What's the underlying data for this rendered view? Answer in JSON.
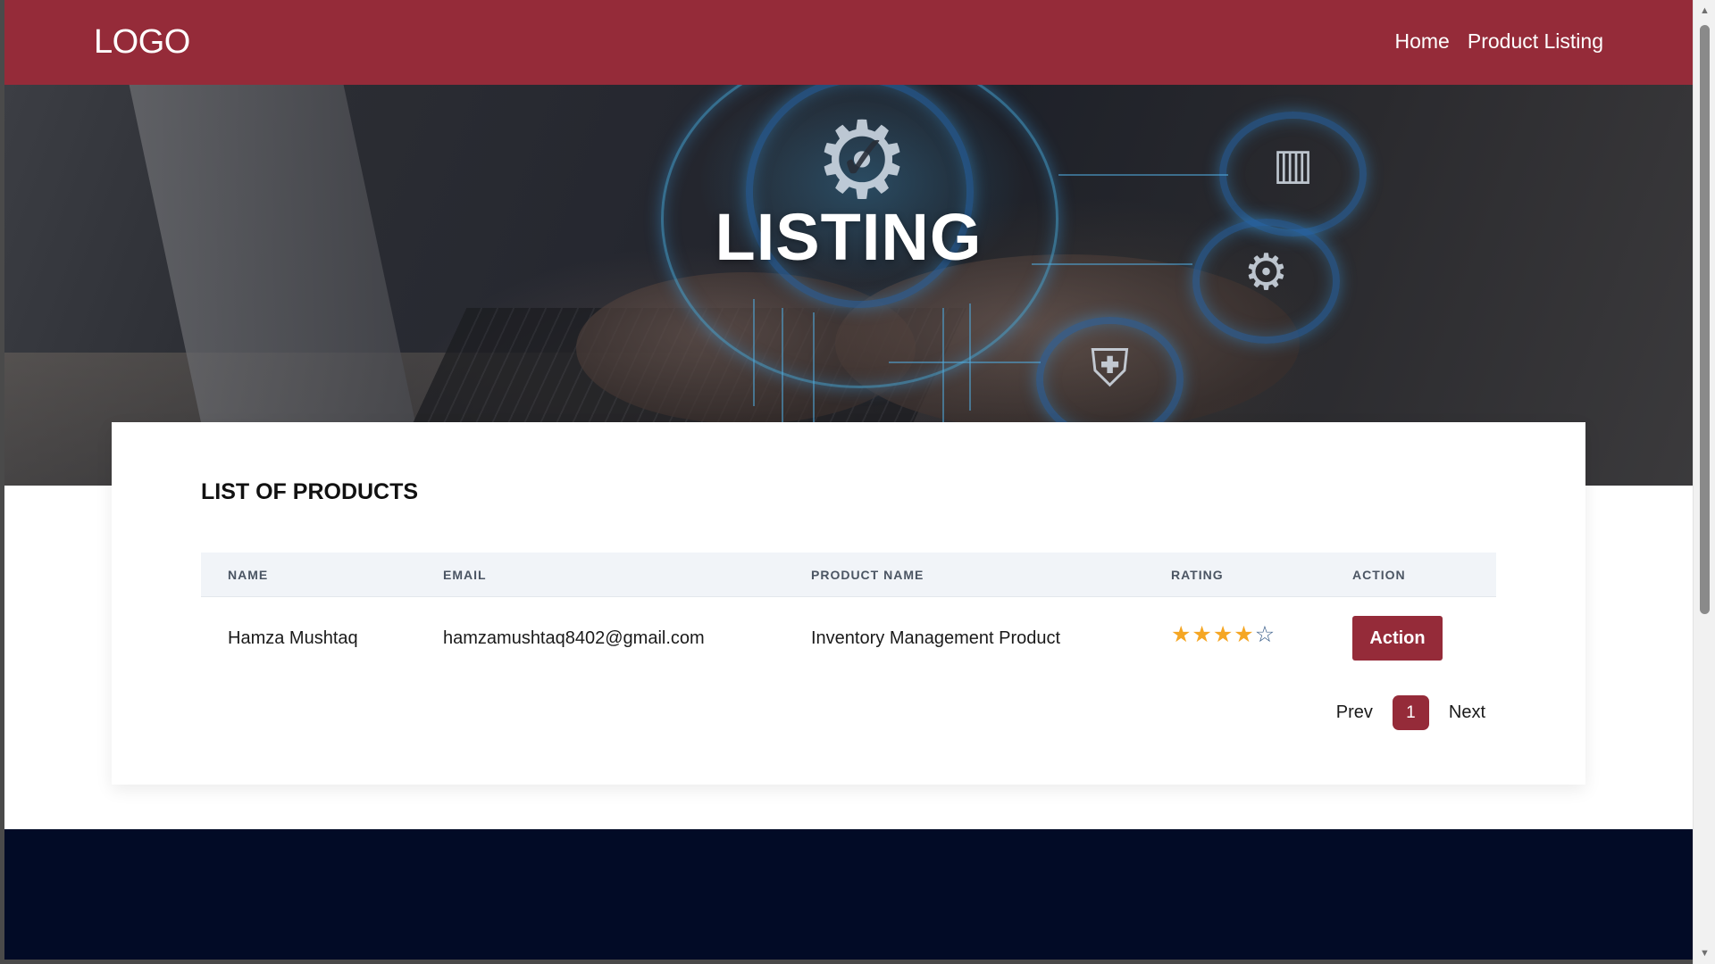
{
  "navbar": {
    "logo": "LOGO",
    "links": [
      "Home",
      "Product Listing"
    ]
  },
  "hero": {
    "title": "LISTING"
  },
  "products": {
    "heading": "LIST OF PRODUCTS",
    "columns": [
      "NAME",
      "EMAIL",
      "PRODUCT NAME",
      "RATING",
      "ACTION"
    ],
    "rows": [
      {
        "name": "Hamza Mushtaq",
        "email": "hamzamushtaq8402@gmail.com",
        "product_name": "Inventory Management Product",
        "rating": 4,
        "rating_max": 5,
        "action_label": "Action"
      }
    ]
  },
  "pagination": {
    "prev": "Prev",
    "current": "1",
    "next": "Next"
  },
  "colors": {
    "brand": "#952b39",
    "footer": "#020b26",
    "star": "#f5a623"
  }
}
